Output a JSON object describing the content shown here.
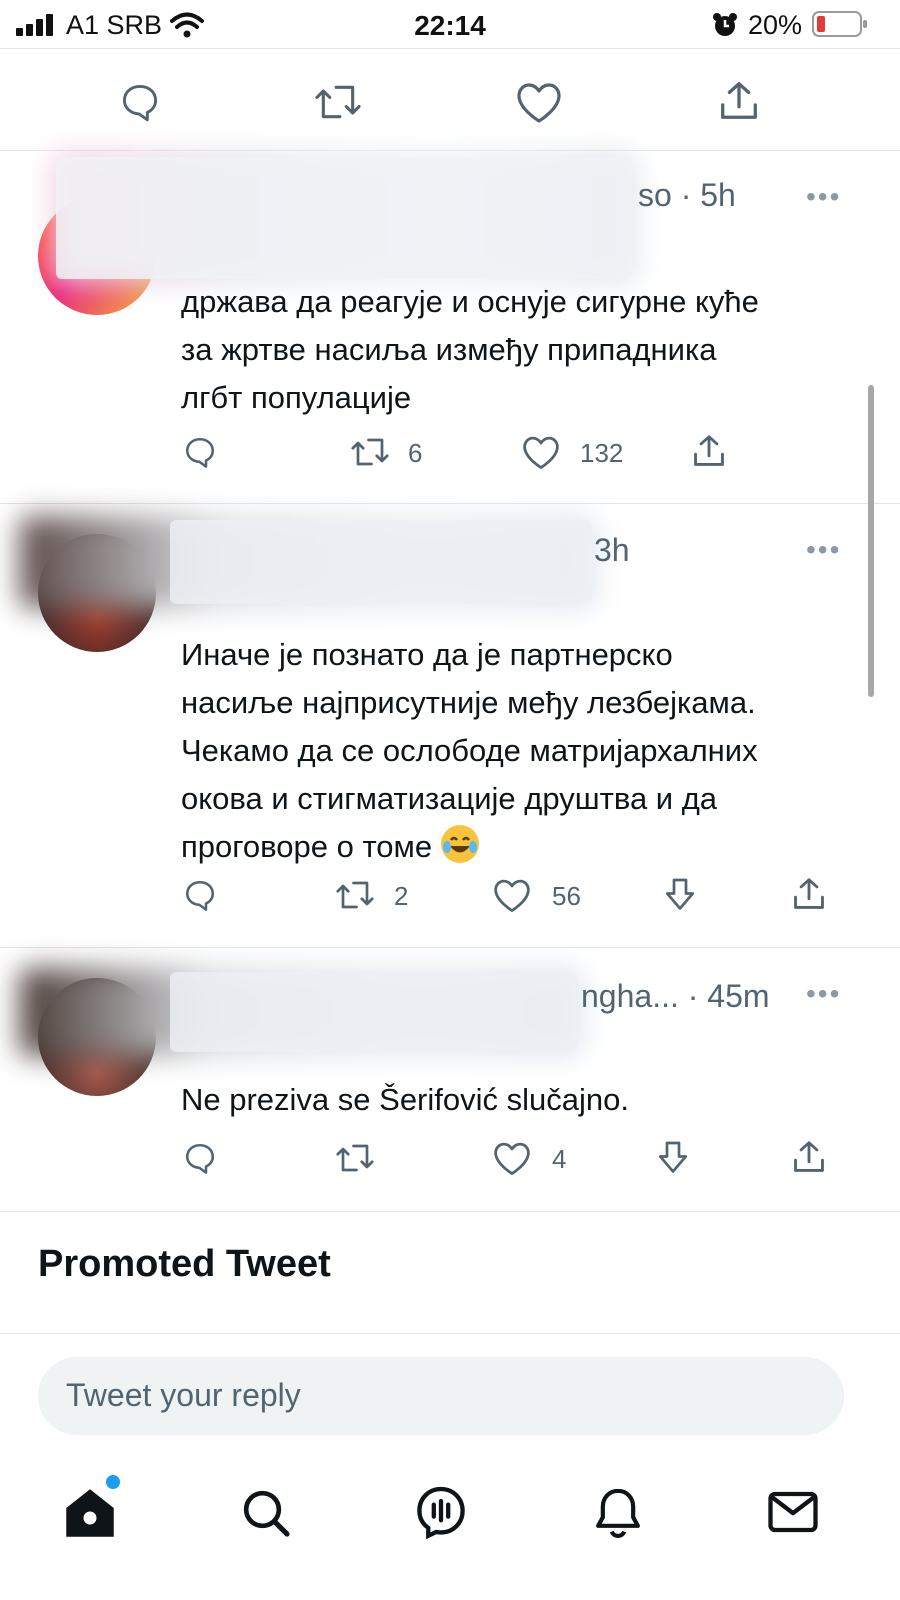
{
  "status_bar": {
    "carrier": "A1 SRB",
    "time": "22:14",
    "battery": "20%"
  },
  "tweets": [
    {
      "meta": "so · 5h",
      "text_lines": [
        "држава да реагује и оснује сигурне куће",
        "за жртве насиља између припадника",
        "лгбт популације"
      ],
      "retweets": "6",
      "likes": "132"
    },
    {
      "meta": "3h",
      "text_lines": [
        "Иначе је познато да је партнерско",
        "насиље најприсутније међу лезбејкама.",
        "Чекамо да се ослободе матријархалних",
        "окова и стигматизације друштва и да",
        "проговоре о томе"
      ],
      "retweets": "2",
      "likes": "56"
    },
    {
      "meta": "ngha... · 45m",
      "text_lines": [
        "Ne preziva se Šerifović slučajno."
      ],
      "retweets": "",
      "likes": "4"
    }
  ],
  "more_label": "•••",
  "promoted_label": "Promoted Tweet",
  "reply": {
    "placeholder": "Tweet your reply"
  },
  "icons": {
    "reply": "reply-icon",
    "retweet": "retweet-icon",
    "like": "heart-icon",
    "share": "share-icon",
    "downvote": "downvote-icon",
    "home": "home-icon",
    "search": "search-icon",
    "spaces": "spaces-icon",
    "notifications": "bell-icon",
    "messages": "mail-icon"
  },
  "colors": {
    "accent": "#1d9bf0",
    "battery_low": "#e53935",
    "icon": "#536471"
  }
}
